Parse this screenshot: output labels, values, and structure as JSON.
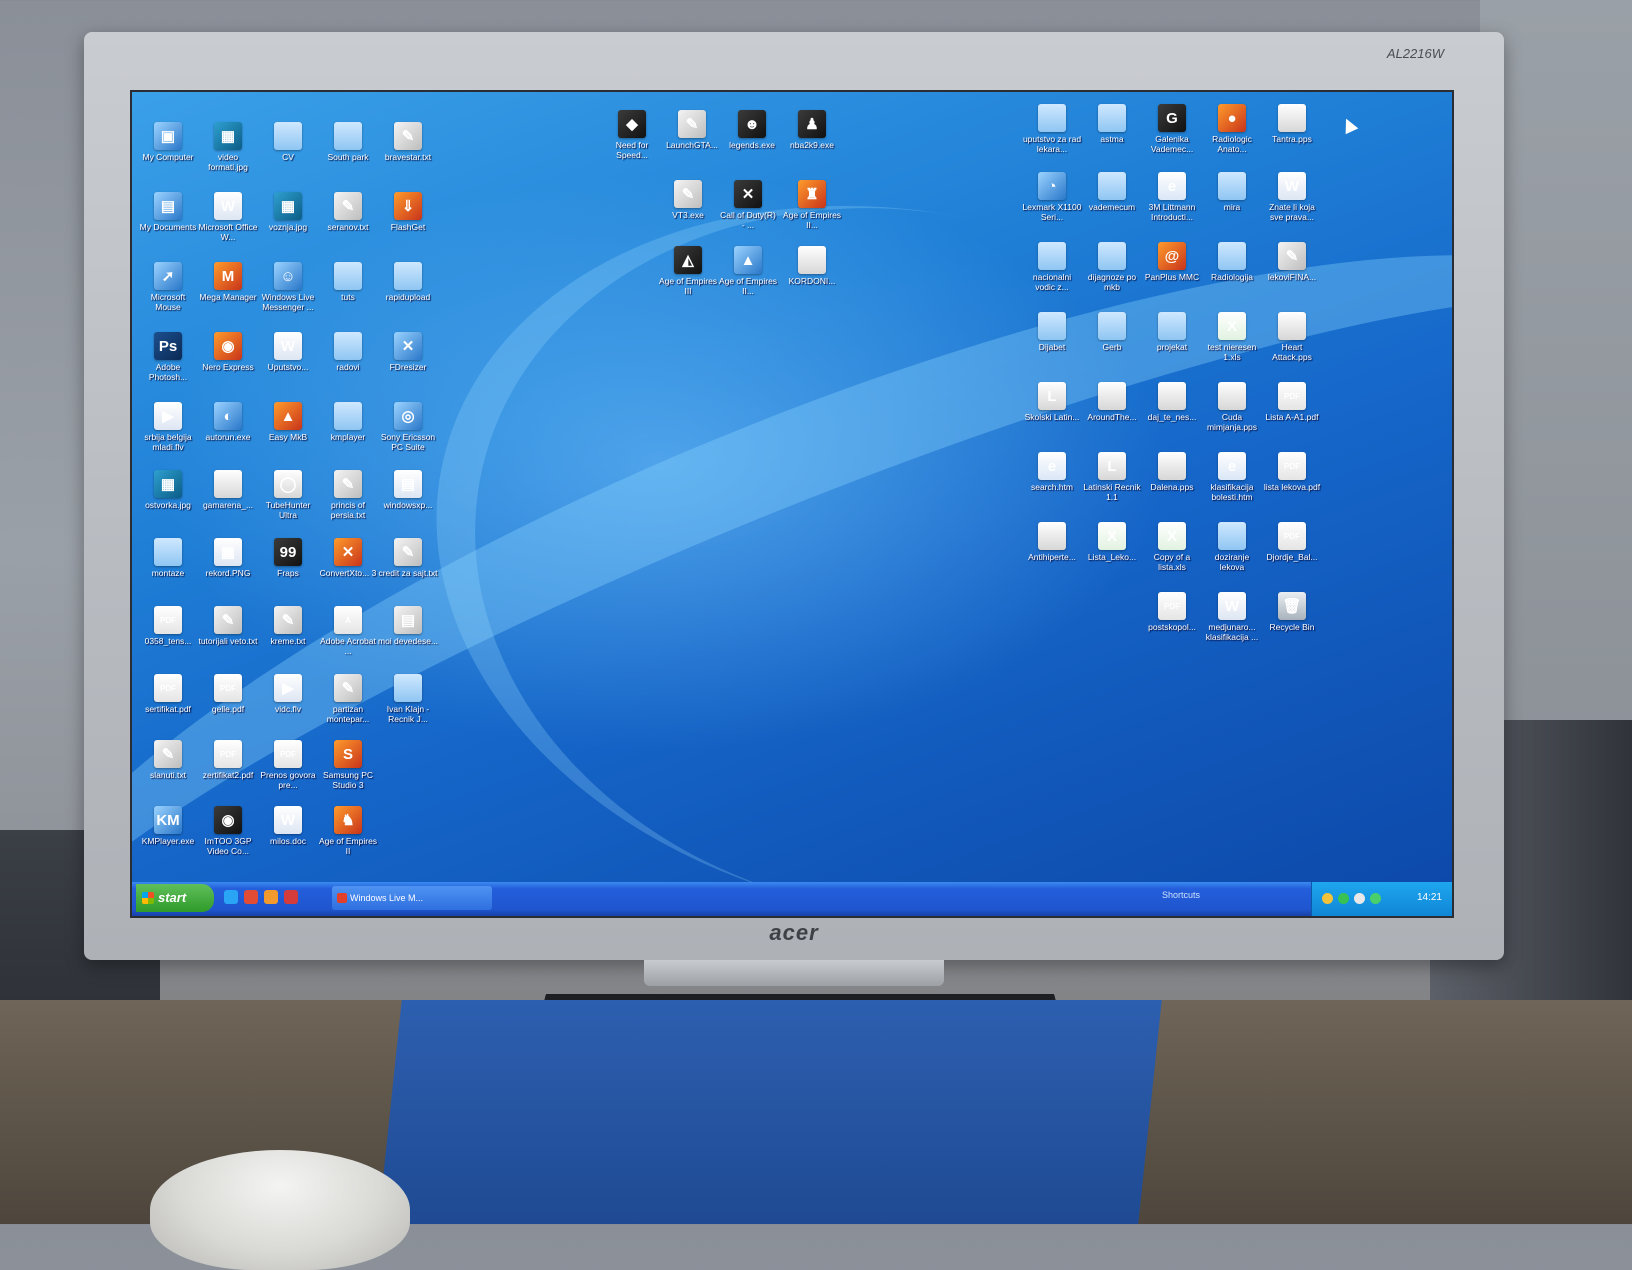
{
  "monitor": {
    "model": "AL2216W",
    "brand": "acer"
  },
  "desktop": {
    "icons": [
      {
        "label": "My Computer",
        "type": "sys",
        "glyph": "▣",
        "icon": "computer-icon"
      },
      {
        "label": "video formati.jpg",
        "type": "image",
        "glyph": "▦",
        "icon": "image-file-icon"
      },
      {
        "label": "CV",
        "type": "folder",
        "glyph": "",
        "icon": "folder-icon"
      },
      {
        "label": "South park",
        "type": "folder",
        "glyph": "",
        "icon": "folder-icon"
      },
      {
        "label": "bravestar.txt",
        "type": "txt",
        "glyph": "✎",
        "icon": "text-file-icon"
      },
      {
        "label": "My Documents",
        "type": "sys",
        "glyph": "▤",
        "icon": "documents-icon"
      },
      {
        "label": "Microsoft Office W...",
        "type": "doc",
        "glyph": "W",
        "icon": "word-icon"
      },
      {
        "label": "voznja.jpg",
        "type": "image",
        "glyph": "▦",
        "icon": "image-file-icon"
      },
      {
        "label": "seranov.txt",
        "type": "txt",
        "glyph": "✎",
        "icon": "text-file-icon"
      },
      {
        "label": "FlashGet",
        "type": "app",
        "glyph": "⇓",
        "icon": "flashget-icon"
      },
      {
        "label": "Microsoft Mouse",
        "type": "sys",
        "glyph": "➚",
        "icon": "mouse-icon"
      },
      {
        "label": "Mega Manager",
        "type": "app",
        "glyph": "M",
        "icon": "mega-manager-icon"
      },
      {
        "label": "Windows Live Messenger ...",
        "type": "sys",
        "glyph": "☺",
        "icon": "messenger-icon"
      },
      {
        "label": "tuts",
        "type": "folder",
        "glyph": "",
        "icon": "folder-icon"
      },
      {
        "label": "rapidupload",
        "type": "folder",
        "glyph": "",
        "icon": "folder-icon"
      },
      {
        "label": "Adobe Photosh...",
        "type": "ps",
        "glyph": "Ps",
        "icon": "photoshop-icon"
      },
      {
        "label": "Nero Express",
        "type": "app",
        "glyph": "◉",
        "icon": "nero-icon"
      },
      {
        "label": "Uputstvo...",
        "type": "doc",
        "glyph": "W",
        "icon": "document-icon"
      },
      {
        "label": "radovi",
        "type": "folder",
        "glyph": "",
        "icon": "folder-icon"
      },
      {
        "label": "FDresizer",
        "type": "sys",
        "glyph": "✕",
        "icon": "resizer-icon"
      },
      {
        "label": "srbija belgija mladi.flv",
        "type": "doc",
        "glyph": "▶",
        "icon": "video-file-icon"
      },
      {
        "label": "autorun.exe",
        "type": "sys",
        "glyph": "◐",
        "icon": "exe-icon"
      },
      {
        "label": "Easy MkB",
        "type": "app",
        "glyph": "▲",
        "icon": "app-icon"
      },
      {
        "label": "kmplayer",
        "type": "folder",
        "glyph": "",
        "icon": "folder-icon"
      },
      {
        "label": "Sony Ericsson PC Suite",
        "type": "sys",
        "glyph": "◎",
        "icon": "phone-suite-icon"
      },
      {
        "label": "ostvorka.jpg",
        "type": "image",
        "glyph": "▦",
        "icon": "image-file-icon"
      },
      {
        "label": "gamarena_...",
        "type": "blank",
        "glyph": "",
        "icon": "file-icon"
      },
      {
        "label": "TubeHunter Ultra",
        "type": "blank",
        "glyph": "◯",
        "icon": "tubehunter-icon"
      },
      {
        "label": "princis of persia.txt",
        "type": "txt",
        "glyph": "✎",
        "icon": "text-file-icon"
      },
      {
        "label": "windowsxp...",
        "type": "doc",
        "glyph": "▤",
        "icon": "document-icon"
      },
      {
        "label": "montaze",
        "type": "folder",
        "glyph": "",
        "icon": "folder-icon"
      },
      {
        "label": "rekord.PNG",
        "type": "doc",
        "glyph": "▦",
        "icon": "image-file-icon"
      },
      {
        "label": "Fraps",
        "type": "exe",
        "glyph": "99",
        "icon": "fraps-icon"
      },
      {
        "label": "ConvertXto... 3",
        "type": "app",
        "glyph": "✕",
        "icon": "convertx-icon"
      },
      {
        "label": "credit za sajt.txt",
        "type": "txt",
        "glyph": "✎",
        "icon": "text-file-icon"
      },
      {
        "label": "0358_tens...",
        "type": "pdf",
        "glyph": "PDF",
        "icon": "pdf-icon"
      },
      {
        "label": "tutorijali veto.txt",
        "type": "txt",
        "glyph": "✎",
        "icon": "text-file-icon"
      },
      {
        "label": "kreme.txt",
        "type": "txt",
        "glyph": "✎",
        "icon": "text-file-icon"
      },
      {
        "label": "Adobe Acrobat ...",
        "type": "pdf",
        "glyph": "A",
        "icon": "acrobat-icon"
      },
      {
        "label": "moi devedese...",
        "type": "txt",
        "glyph": "▤",
        "icon": "text-file-icon"
      },
      {
        "label": "sertifikat.pdf",
        "type": "pdf",
        "glyph": "PDF",
        "icon": "pdf-icon"
      },
      {
        "label": "gelle.pdf",
        "type": "pdf",
        "glyph": "PDF",
        "icon": "pdf-icon"
      },
      {
        "label": "vidc.flv",
        "type": "doc",
        "glyph": "▶",
        "icon": "video-file-icon"
      },
      {
        "label": "partizan montepar...",
        "type": "txt",
        "glyph": "✎",
        "icon": "text-file-icon"
      },
      {
        "label": "Ivan Klajn - Recnik J...",
        "type": "folder",
        "glyph": "",
        "icon": "folder-icon"
      },
      {
        "label": "slanuti.txt",
        "type": "txt",
        "glyph": "✎",
        "icon": "text-file-icon"
      },
      {
        "label": "zertifikat2.pdf",
        "type": "pdf",
        "glyph": "PDF",
        "icon": "pdf-icon"
      },
      {
        "label": "Prenos govora pre...",
        "type": "pdf",
        "glyph": "PDF",
        "icon": "pdf-icon"
      },
      {
        "label": "Samsung PC Studio 3",
        "type": "app",
        "glyph": "S",
        "icon": "samsung-icon"
      },
      {
        "label": "KMPlayer.exe",
        "type": "sys",
        "glyph": "KM",
        "icon": "kmplayer-icon"
      },
      {
        "label": "ImTOO 3GP Video Co...",
        "type": "exe",
        "glyph": "◉",
        "icon": "video-converter-icon"
      },
      {
        "label": "milos.doc",
        "type": "doc",
        "glyph": "W",
        "icon": "word-doc-icon"
      },
      {
        "label": "Age of Empires II",
        "type": "app",
        "glyph": "♞",
        "icon": "game-icon"
      },
      {
        "label": "Need for Speed...",
        "type": "exe",
        "glyph": "◆",
        "icon": "game-icon"
      },
      {
        "label": "LaunchGTA...",
        "type": "txt",
        "glyph": "✎",
        "icon": "launcher-icon"
      },
      {
        "label": "legends.exe",
        "type": "exe",
        "glyph": "☻",
        "icon": "game-icon"
      },
      {
        "label": "nba2k9.exe",
        "type": "exe",
        "glyph": "♟",
        "icon": "game-icon"
      },
      {
        "label": "VT3.exe",
        "type": "txt",
        "glyph": "✎",
        "icon": "launcher-icon"
      },
      {
        "label": "Call of Duty(R) - ...",
        "type": "exe",
        "glyph": "✕",
        "icon": "game-icon"
      },
      {
        "label": "Age of Empires II...",
        "type": "app",
        "glyph": "♜",
        "icon": "game-icon"
      },
      {
        "label": "Age of Empires III",
        "type": "exe",
        "glyph": "◭",
        "icon": "game-icon"
      },
      {
        "label": "Age of Empires II...",
        "type": "sys",
        "glyph": "▲",
        "icon": "game-icon"
      },
      {
        "label": "KORDONI...",
        "type": "blank",
        "glyph": "",
        "icon": "file-icon"
      },
      {
        "label": "uputstvo za rad lekara...",
        "type": "folder",
        "glyph": "",
        "icon": "folder-icon"
      },
      {
        "label": "astma",
        "type": "folder",
        "glyph": "",
        "icon": "folder-icon"
      },
      {
        "label": "Galenika Vademec...",
        "type": "exe",
        "glyph": "G",
        "icon": "galenika-icon"
      },
      {
        "label": "Radiologic Anato...",
        "type": "app",
        "glyph": "●",
        "icon": "radiology-app-icon"
      },
      {
        "label": "Tantra.pps",
        "type": "blank",
        "glyph": "",
        "icon": "presentation-icon"
      },
      {
        "label": "Lexmark X1100 Seri...",
        "type": "sys",
        "glyph": "◔",
        "icon": "printer-icon"
      },
      {
        "label": "vademecum",
        "type": "folder",
        "glyph": "",
        "icon": "folder-icon"
      },
      {
        "label": "3M Littmann Introducti...",
        "type": "html",
        "glyph": "e",
        "icon": "html-file-icon"
      },
      {
        "label": "mira",
        "type": "folder",
        "glyph": "",
        "icon": "folder-icon"
      },
      {
        "label": "Znate li koja sve prava...",
        "type": "doc",
        "glyph": "W",
        "icon": "word-doc-icon"
      },
      {
        "label": "nacionalni vodic z...",
        "type": "folder",
        "glyph": "",
        "icon": "folder-icon"
      },
      {
        "label": "dijagnoze po mkb",
        "type": "folder",
        "glyph": "",
        "icon": "folder-icon"
      },
      {
        "label": "PanPlus MMC",
        "type": "app",
        "glyph": "@",
        "icon": "panplus-icon"
      },
      {
        "label": "Radiologija",
        "type": "folder",
        "glyph": "",
        "icon": "folder-icon"
      },
      {
        "label": "lekoviFINA...",
        "type": "txt",
        "glyph": "✎",
        "icon": "text-file-icon"
      },
      {
        "label": "Dijabet",
        "type": "folder",
        "glyph": "",
        "icon": "folder-icon"
      },
      {
        "label": "Gerb",
        "type": "folder",
        "glyph": "",
        "icon": "folder-icon"
      },
      {
        "label": "projekat",
        "type": "folder",
        "glyph": "",
        "icon": "folder-icon"
      },
      {
        "label": "test nieresen 1.xls",
        "type": "xls",
        "glyph": "X",
        "icon": "excel-file-icon"
      },
      {
        "label": "Heart Attack.pps",
        "type": "blank",
        "glyph": "",
        "icon": "presentation-icon"
      },
      {
        "label": "Skolski Latin...",
        "type": "blank",
        "glyph": "L",
        "icon": "dictionary-icon"
      },
      {
        "label": "AroundThe...",
        "type": "blank",
        "glyph": "",
        "icon": "presentation-icon"
      },
      {
        "label": "daj_te_nes...",
        "type": "blank",
        "glyph": "",
        "icon": "presentation-icon"
      },
      {
        "label": "Cuda mimjanja.pps",
        "type": "blank",
        "glyph": "",
        "icon": "presentation-icon"
      },
      {
        "label": "Lista A-A1.pdf",
        "type": "pdf",
        "glyph": "PDF",
        "icon": "pdf-icon"
      },
      {
        "label": "search.htm",
        "type": "html",
        "glyph": "e",
        "icon": "html-file-icon"
      },
      {
        "label": "Latinski Recnik 1.1",
        "type": "blank",
        "glyph": "L",
        "icon": "dictionary-icon"
      },
      {
        "label": "Dalena.pps",
        "type": "blank",
        "glyph": "",
        "icon": "presentation-icon"
      },
      {
        "label": "klasifikacija bolesti.htm",
        "type": "html",
        "glyph": "e",
        "icon": "html-file-icon"
      },
      {
        "label": "lista lekova.pdf",
        "type": "pdf",
        "glyph": "PDF",
        "icon": "pdf-icon"
      },
      {
        "label": "Antihiperte...",
        "type": "blank",
        "glyph": "",
        "icon": "presentation-icon"
      },
      {
        "label": "Lista_Leko...",
        "type": "xls",
        "glyph": "X",
        "icon": "excel-file-icon"
      },
      {
        "label": "Copy of a lista.xls",
        "type": "xls",
        "glyph": "X",
        "icon": "excel-file-icon"
      },
      {
        "label": "doziranje lekova",
        "type": "folder",
        "glyph": "",
        "icon": "folder-icon"
      },
      {
        "label": "Djordje_Bal...",
        "type": "pdf",
        "glyph": "PDF",
        "icon": "pdf-icon"
      },
      {
        "label": "postskopol...",
        "type": "pdf",
        "glyph": "PDF",
        "icon": "pdf-icon"
      },
      {
        "label": "medjunaro... klasifikacija ...",
        "type": "doc",
        "glyph": "W",
        "icon": "word-doc-icon"
      },
      {
        "label": "Recycle Bin",
        "type": "bin",
        "glyph": "🗑",
        "icon": "recycle-bin-icon"
      }
    ]
  },
  "taskbar": {
    "start_label": "start",
    "window_button": "Windows Live M...",
    "shortcuts_label": "Shortcuts",
    "clock": "14:21"
  }
}
